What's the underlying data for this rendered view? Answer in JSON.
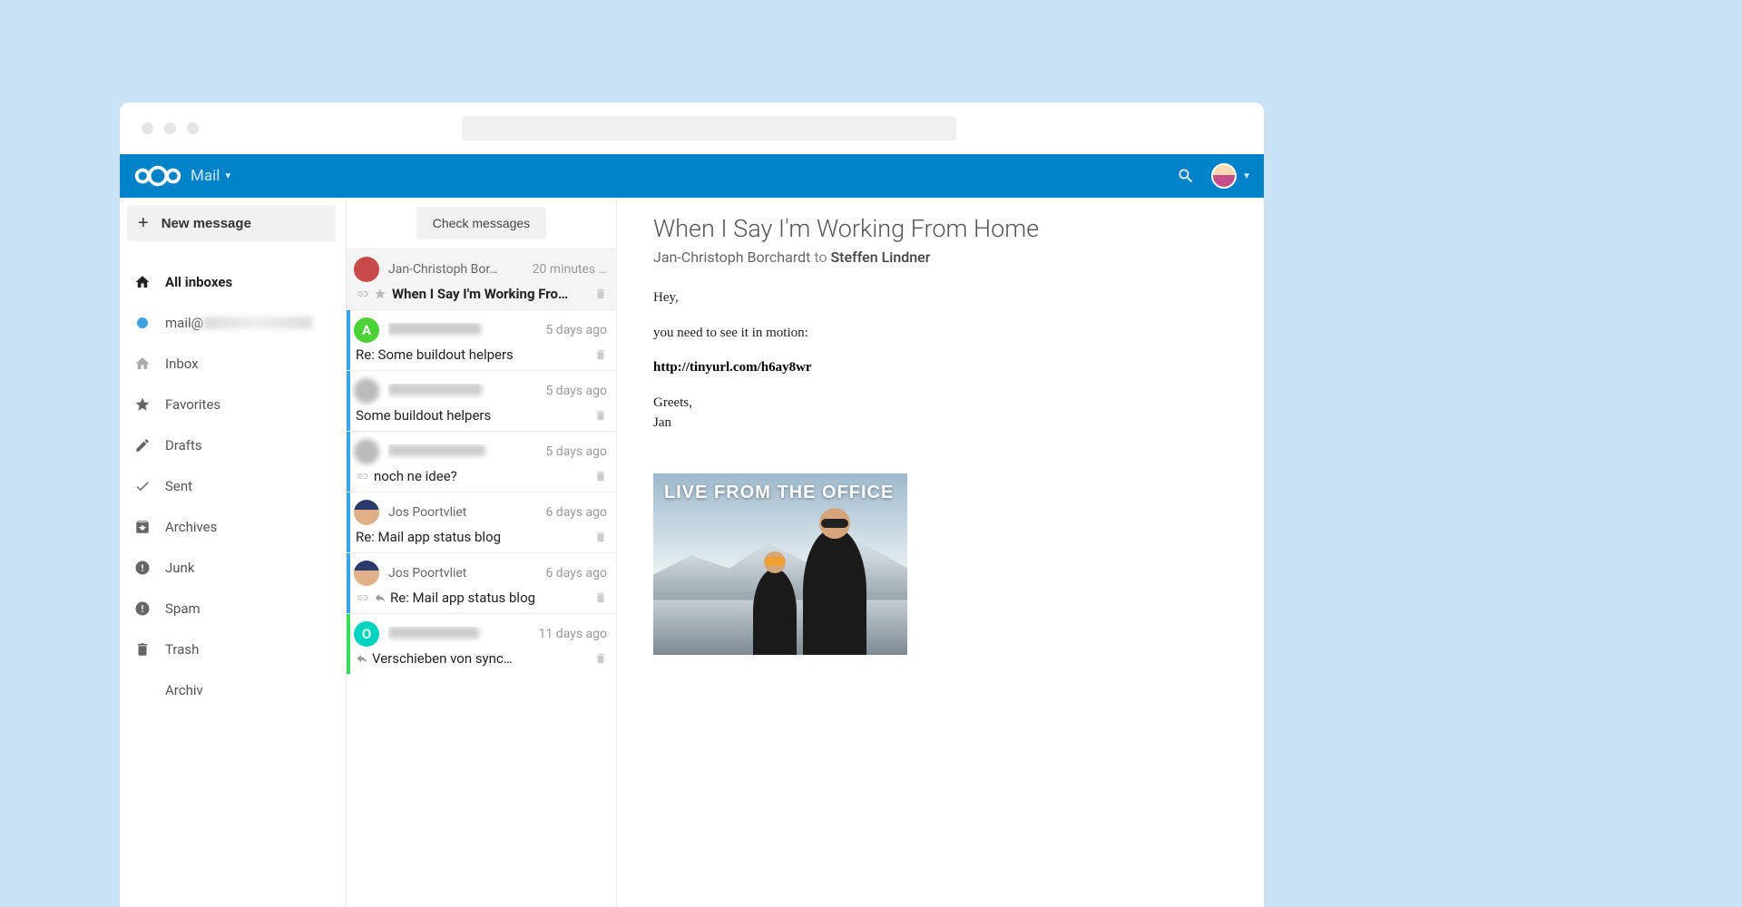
{
  "header": {
    "app_title": "Mail"
  },
  "sidebar": {
    "new_message": "New message",
    "items": [
      {
        "label": "All inboxes",
        "icon": "home"
      },
      {
        "label": "mail@",
        "icon": "bluedot",
        "blurred": true
      },
      {
        "label": "Inbox",
        "icon": "home-outline"
      },
      {
        "label": "Favorites",
        "icon": "star"
      },
      {
        "label": "Drafts",
        "icon": "pencil"
      },
      {
        "label": "Sent",
        "icon": "check"
      },
      {
        "label": "Archives",
        "icon": "archive"
      },
      {
        "label": "Junk",
        "icon": "alert"
      },
      {
        "label": "Spam",
        "icon": "alert"
      },
      {
        "label": "Trash",
        "icon": "trash"
      },
      {
        "label": "Archiv",
        "icon": "none"
      }
    ]
  },
  "msglist": {
    "check": "Check messages",
    "items": [
      {
        "sender": "Jan-Christoph Bor…",
        "time": "20 minutes …",
        "subject": "When I Say I'm Working Fro…",
        "avatar_color": "#c94a4a",
        "avatar_letter": "",
        "active": true,
        "icons": [
          "link",
          "star"
        ],
        "bold": true,
        "unread_bar": false
      },
      {
        "sender_blurred": true,
        "time": "5 days ago",
        "subject": "Re: Some buildout helpers",
        "avatar_color": "#4cd137",
        "avatar_letter": "A",
        "unread_bar": true
      },
      {
        "sender_blurred": true,
        "time": "5 days ago",
        "subject": "Some buildout helpers",
        "avatar_blur": true,
        "unread_bar": true
      },
      {
        "sender_blurred": true,
        "time": "5 days ago",
        "subject": "noch ne idee?",
        "avatar_blur": true,
        "icons": [
          "link"
        ],
        "unread_bar": true
      },
      {
        "sender": "Jos Poortvliet",
        "time": "6 days ago",
        "subject": "Re: Mail app status blog",
        "avatar_hat": true,
        "unread_bar": true
      },
      {
        "sender": "Jos Poortvliet",
        "time": "6 days ago",
        "subject": "Re: Mail app status blog",
        "avatar_hat": true,
        "icons": [
          "link",
          "reply"
        ],
        "unread_bar": true
      },
      {
        "sender_blurred": true,
        "time": "11 days ago",
        "subject": "Verschieben von sync…",
        "avatar_color": "#00d4c1",
        "avatar_letter": "O",
        "icons": [
          "reply"
        ],
        "green_bar": true
      }
    ]
  },
  "content": {
    "title": "When I Say I'm Working From Home",
    "from": "Jan-Christoph Borchardt",
    "to_word": "to",
    "to": "Steffen Lindner",
    "body_lines": [
      "Hey,",
      "you need to see it in motion:"
    ],
    "link": "http://tinyurl.com/h6ay8wr",
    "body_lines2": [
      "Greets,",
      "Jan"
    ],
    "embed_caption": "LIVE FROM THE OFFICE"
  }
}
